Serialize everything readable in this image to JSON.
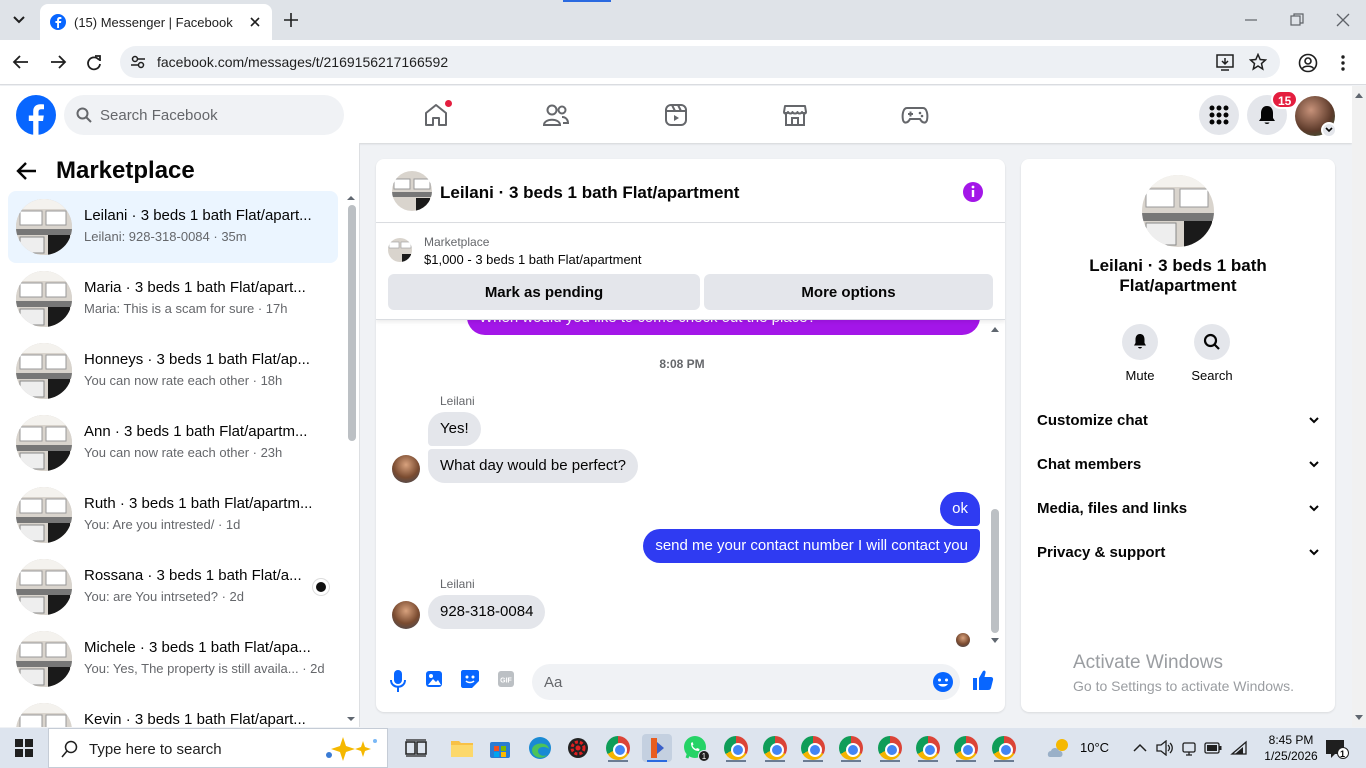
{
  "browser": {
    "tab_title": "(15) Messenger | Facebook",
    "url": "facebook.com/messages/t/2169156217166592"
  },
  "header": {
    "search_placeholder": "Search Facebook",
    "notification_count": "15"
  },
  "sidebar": {
    "title": "Marketplace",
    "conversations": [
      {
        "name": "Leilani · 3 beds 1 bath Flat/apart...",
        "preview": "Leilani: 928-318-0084 · 35m"
      },
      {
        "name": "Maria · 3 beds 1 bath Flat/apart...",
        "preview": "Maria: This is a scam for sure · 17h"
      },
      {
        "name": "Honneys · 3 beds 1 bath Flat/ap...",
        "preview": "You can now rate each other · 18h"
      },
      {
        "name": "Ann · 3 beds 1 bath Flat/apartm...",
        "preview": "You can now rate each other · 23h"
      },
      {
        "name": "Ruth · 3 beds 1 bath Flat/apartm...",
        "preview": "You: Are you intrested/ · 1d"
      },
      {
        "name": "Rossana · 3 beds 1 bath Flat/a...",
        "preview": "You: are You intrseted? · 2d"
      },
      {
        "name": "Michele · 3 beds 1 bath Flat/apa...",
        "preview": "You: Yes, The property is still availa... · 2d"
      },
      {
        "name": "Kevin · 3 beds 1 bath Flat/apart...",
        "preview": ""
      }
    ]
  },
  "chat": {
    "title": "Leilani · 3 beds 1 bath Flat/apartment",
    "listing_category": "Marketplace",
    "listing_desc": "$1,000 - 3 beds 1 bath Flat/apartment",
    "mark_pending": "Mark as pending",
    "more_options": "More options",
    "prev_message": "When would you like to come check out the place?",
    "timestamp": "8:08 PM",
    "sender1": "Leilani",
    "msg1": "Yes!",
    "msg2": "What day would be perfect?",
    "msg3": "ok",
    "msg4": "send me your contact number I will contact you",
    "sender2": "Leilani",
    "msg5": "928-318-0084",
    "composer_placeholder": "Aa"
  },
  "right_panel": {
    "name": "Leilani · 3 beds 1 bath Flat/apartment",
    "mute_label": "Mute",
    "search_label": "Search",
    "sections": [
      "Customize chat",
      "Chat members",
      "Media, files and links",
      "Privacy & support"
    ]
  },
  "watermark": {
    "title": "Activate Windows",
    "subtitle": "Go to Settings to activate Windows."
  },
  "taskbar": {
    "search_placeholder": "Type here to search",
    "temperature": "10°C",
    "time": "8:45 PM",
    "date": "1/25/2026",
    "notification_count": "1"
  }
}
